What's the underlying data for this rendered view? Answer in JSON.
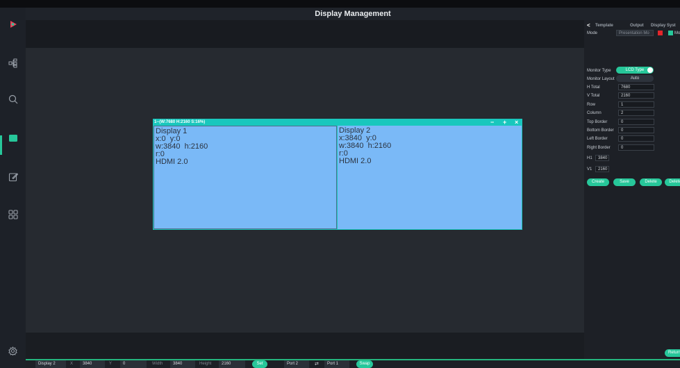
{
  "title": "Display Management",
  "sidebar": {
    "items": [
      {
        "icon": "logo-play-icon"
      },
      {
        "icon": "network-icon"
      },
      {
        "icon": "search-icon"
      },
      {
        "icon": "display-icon",
        "active": true
      },
      {
        "icon": "edit-icon"
      },
      {
        "icon": "grid-icon"
      },
      {
        "icon": "gear-icon"
      }
    ]
  },
  "screen": {
    "header": "1--(W:7680 H:2160 S:16%)",
    "controls": {
      "minus": "−",
      "plus": "+",
      "close": "×"
    },
    "displays": [
      {
        "name": "Display 1",
        "pos": "x:0  y:0",
        "size": "w:3840  h:2160",
        "rotation": "r:0",
        "port": "HDMI 2.0"
      },
      {
        "name": "Display 2",
        "pos": "x:3840  y:0",
        "size": "w:3840  h:2160",
        "rotation": "r:0",
        "port": "HDMI 2.0"
      }
    ]
  },
  "right_panel": {
    "back": "<",
    "tabs": [
      "Template",
      "Output",
      "Display Syst"
    ],
    "mode_label": "Mode",
    "mode_value": "Presentation Mo",
    "mo_label": "Mo",
    "monitor_type_label": "Monitor Type",
    "monitor_type_value": "LCD Type",
    "monitor_layout_label": "Monitor Layout",
    "monitor_layout_value": "Auto",
    "fields": [
      {
        "label": "H Total",
        "value": "7680"
      },
      {
        "label": "V Total",
        "value": "2160"
      },
      {
        "label": "Row",
        "value": "1"
      },
      {
        "label": "Column",
        "value": "2"
      },
      {
        "label": "Top Border",
        "value": "0"
      },
      {
        "label": "Bottom Border",
        "value": "0"
      },
      {
        "label": "Left Border",
        "value": "0"
      },
      {
        "label": "Right Border",
        "value": "0"
      }
    ],
    "h1_label": "H1",
    "h1_value": "3840",
    "v1_label": "V1",
    "v1_value": "2160",
    "buttons": [
      "Create",
      "Save",
      "Delete",
      "Delete"
    ],
    "return_label": "Return"
  },
  "bottom_bar": {
    "display_value": "Display 2",
    "x_label": "X",
    "x_value": "3840",
    "y_label": "Y",
    "y_value": "0",
    "width_label": "Width",
    "width_value": "3840",
    "height_label": "Height",
    "height_value": "2160",
    "set_label": "Set",
    "port_a": "Port 2",
    "port_b": "Port 1",
    "swap_label": "Swap"
  },
  "colors": {
    "accent": "#27c79a",
    "display_fill": "#7ab9f7",
    "screen_border": "#19c7bd"
  }
}
